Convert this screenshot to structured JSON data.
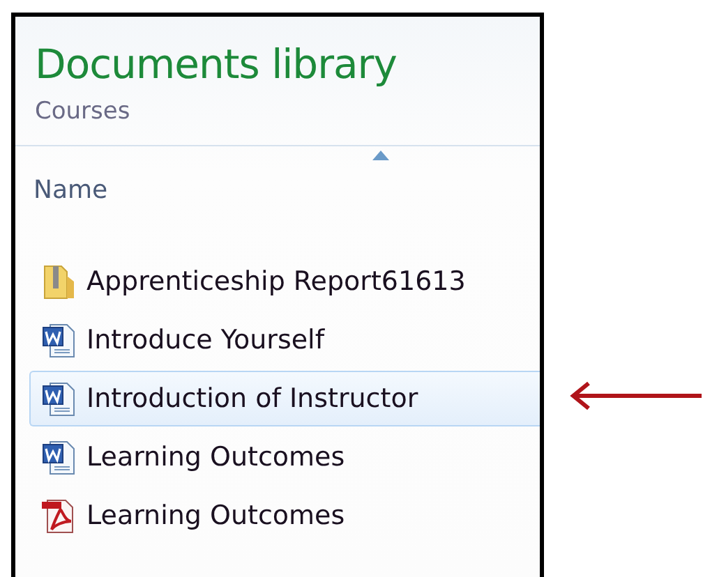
{
  "header": {
    "title": "Documents library",
    "subtitle": "Courses"
  },
  "column": {
    "label": "Name",
    "sorted_ascending": true
  },
  "files": [
    {
      "name": "Apprenticeship Report61613",
      "kind": "zip",
      "selected": false
    },
    {
      "name": "Introduce Yourself",
      "kind": "word",
      "selected": false
    },
    {
      "name": "Introduction of Instructor",
      "kind": "word",
      "selected": true
    },
    {
      "name": "Learning Outcomes",
      "kind": "word",
      "selected": false
    },
    {
      "name": "Learning Outcomes",
      "kind": "pdf",
      "selected": false
    }
  ]
}
